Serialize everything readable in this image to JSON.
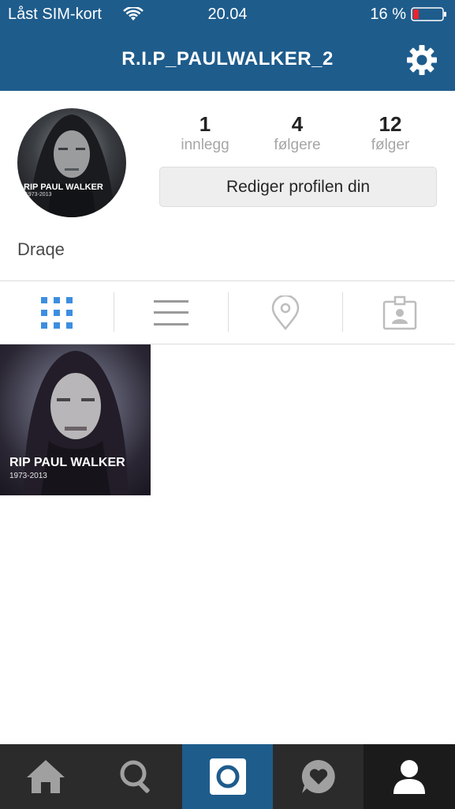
{
  "status_bar": {
    "carrier": "Låst SIM-kort",
    "time": "20.04",
    "battery": "16 %"
  },
  "nav": {
    "title": "R.I.P_PAULWALKER_2",
    "colors": {
      "bar": "#1e5c8c"
    }
  },
  "profile": {
    "avatar_text": "RIP PAUL WALKER",
    "avatar_subtext": "1973-2013",
    "stats": [
      {
        "value": "1",
        "label": "innlegg"
      },
      {
        "value": "4",
        "label": "følgere"
      },
      {
        "value": "12",
        "label": "følger"
      }
    ],
    "edit_button": "Rediger profilen din",
    "bio": "Draqe"
  },
  "view_tabs": [
    {
      "icon": "grid-icon",
      "active": true
    },
    {
      "icon": "list-icon",
      "active": false
    },
    {
      "icon": "location-pin-icon",
      "active": false
    },
    {
      "icon": "tagged-photos-icon",
      "active": false
    }
  ],
  "posts": [
    {
      "caption": "RIP PAUL WALKER",
      "subcaption": "1973-2013"
    }
  ],
  "tab_bar": {
    "items": [
      {
        "icon": "home-icon",
        "active": false
      },
      {
        "icon": "search-icon",
        "active": false
      },
      {
        "icon": "camera-icon",
        "active": false
      },
      {
        "icon": "activity-heart-icon",
        "active": false
      },
      {
        "icon": "profile-icon",
        "active": true
      }
    ],
    "colors": {
      "camera_bg": "#1e5c8c",
      "active_bg": "#1b1b1b",
      "inactive_icon": "#a0a0a0"
    }
  }
}
